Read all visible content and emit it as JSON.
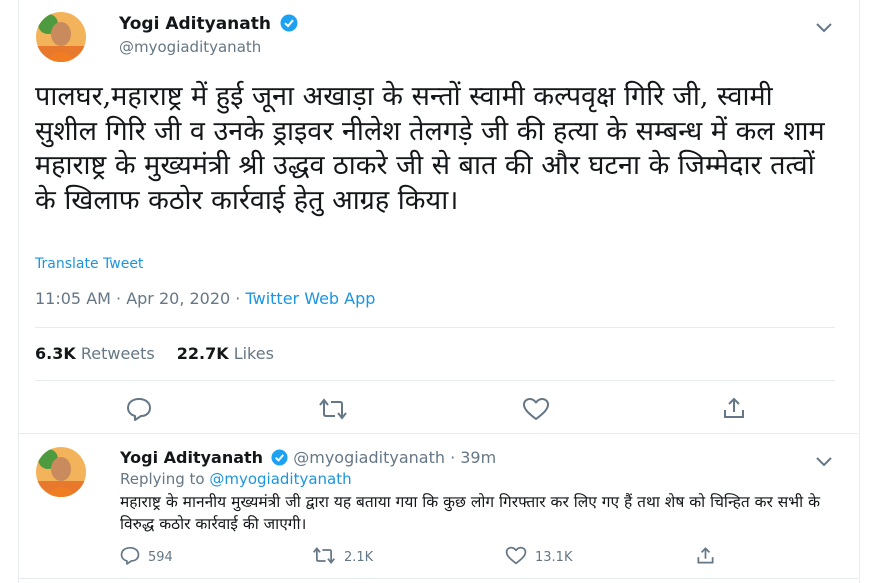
{
  "main_tweet": {
    "author_name": "Yogi Adityanath",
    "author_handle": "@myogiadityanath",
    "text": "पालघर,महाराष्ट्र में हुई जूना अखाड़ा के सन्तों स्वामी कल्पवृक्ष गिरि जी, स्वामी सुशील गिरि जी व उनके ड्राइवर नीलेश तेलगड़े जी की हत्या के सम्बन्ध में कल शाम महाराष्ट्र के मुख्यमंत्री श्री उद्धव ठाकरे जी से बात की और घटना के जिम्मेदार तत्वों के खिलाफ कठोर कार्रवाई हेतु आग्रह किया।",
    "translate_label": "Translate Tweet",
    "timestamp": "11:05 AM · Apr 20, 2020 · ",
    "app": "Twitter Web App",
    "retweets_count": "6.3K",
    "retweets_label": " Retweets",
    "likes_count": "22.7K",
    "likes_label": " Likes"
  },
  "reply_tweet": {
    "author_name": "Yogi Adityanath",
    "author_handle": "@myogiadityanath · 39m",
    "replying_prefix": "Replying to ",
    "replying_to": "@myogiadityanath",
    "text": "महाराष्ट्र के माननीय मुख्यमंत्री जी द्वारा यह बताया गया कि कुछ लोग गिरफ्तार कर लिए गए हैं तथा शेष को चिन्हित कर सभी के विरुद्ध कठोर कार्रवाई की जाएगी।",
    "reply_count": "594",
    "retweet_count": "2.1K",
    "like_count": "13.1K"
  },
  "icons": {
    "verified": "verified-badge-icon",
    "more": "chevron-down-icon",
    "reply": "reply-icon",
    "retweet": "retweet-icon",
    "like": "heart-icon",
    "share": "share-icon"
  },
  "colors": {
    "accent": "#1b95e0",
    "verified": "#1da1f2",
    "muted": "#657786",
    "divider": "#e6ecf0"
  }
}
